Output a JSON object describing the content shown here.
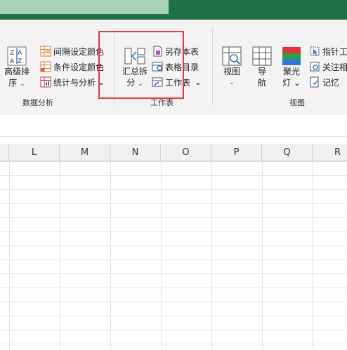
{
  "ribbon": {
    "group_data_analysis": {
      "label": "数据分析",
      "sort_button": {
        "line1": "高级排",
        "line2": "序",
        "caret": "⌄"
      },
      "items": [
        {
          "label": "间隔设定颜色",
          "icon": "grid-color-icon"
        },
        {
          "label": "条件设定颜色",
          "icon": "condition-color-icon"
        },
        {
          "label": "统计与分析",
          "icon": "stats-icon",
          "caret": "⌄"
        }
      ]
    },
    "group_worksheet": {
      "label": "工作表",
      "split_button": {
        "line1": "汇总拆",
        "line2": "分",
        "caret": "⌄"
      },
      "items": [
        {
          "label": "另存本表",
          "icon": "save-sheet-icon"
        },
        {
          "label": "表格目录",
          "icon": "table-directory-icon"
        },
        {
          "label": "工作表",
          "icon": "worksheet-icon",
          "caret": "⌄"
        }
      ]
    },
    "group_view": {
      "label": "视图",
      "buttons": [
        {
          "line1": "视图",
          "line2": "⌄"
        },
        {
          "line1": "导",
          "line2": "航"
        },
        {
          "line1": "聚光",
          "line2": "灯 ⌄"
        }
      ],
      "items": [
        {
          "label": "指针工",
          "icon": "pointer-tool-icon"
        },
        {
          "label": "关注相",
          "icon": "focus-icon"
        },
        {
          "label": "记忆",
          "icon": "memory-icon"
        }
      ]
    }
  },
  "columns": [
    "L",
    "M",
    "N",
    "O",
    "P",
    "Q",
    "R"
  ],
  "colors": {
    "title_green": "#1e7145",
    "highlight_red": "#e53935"
  }
}
